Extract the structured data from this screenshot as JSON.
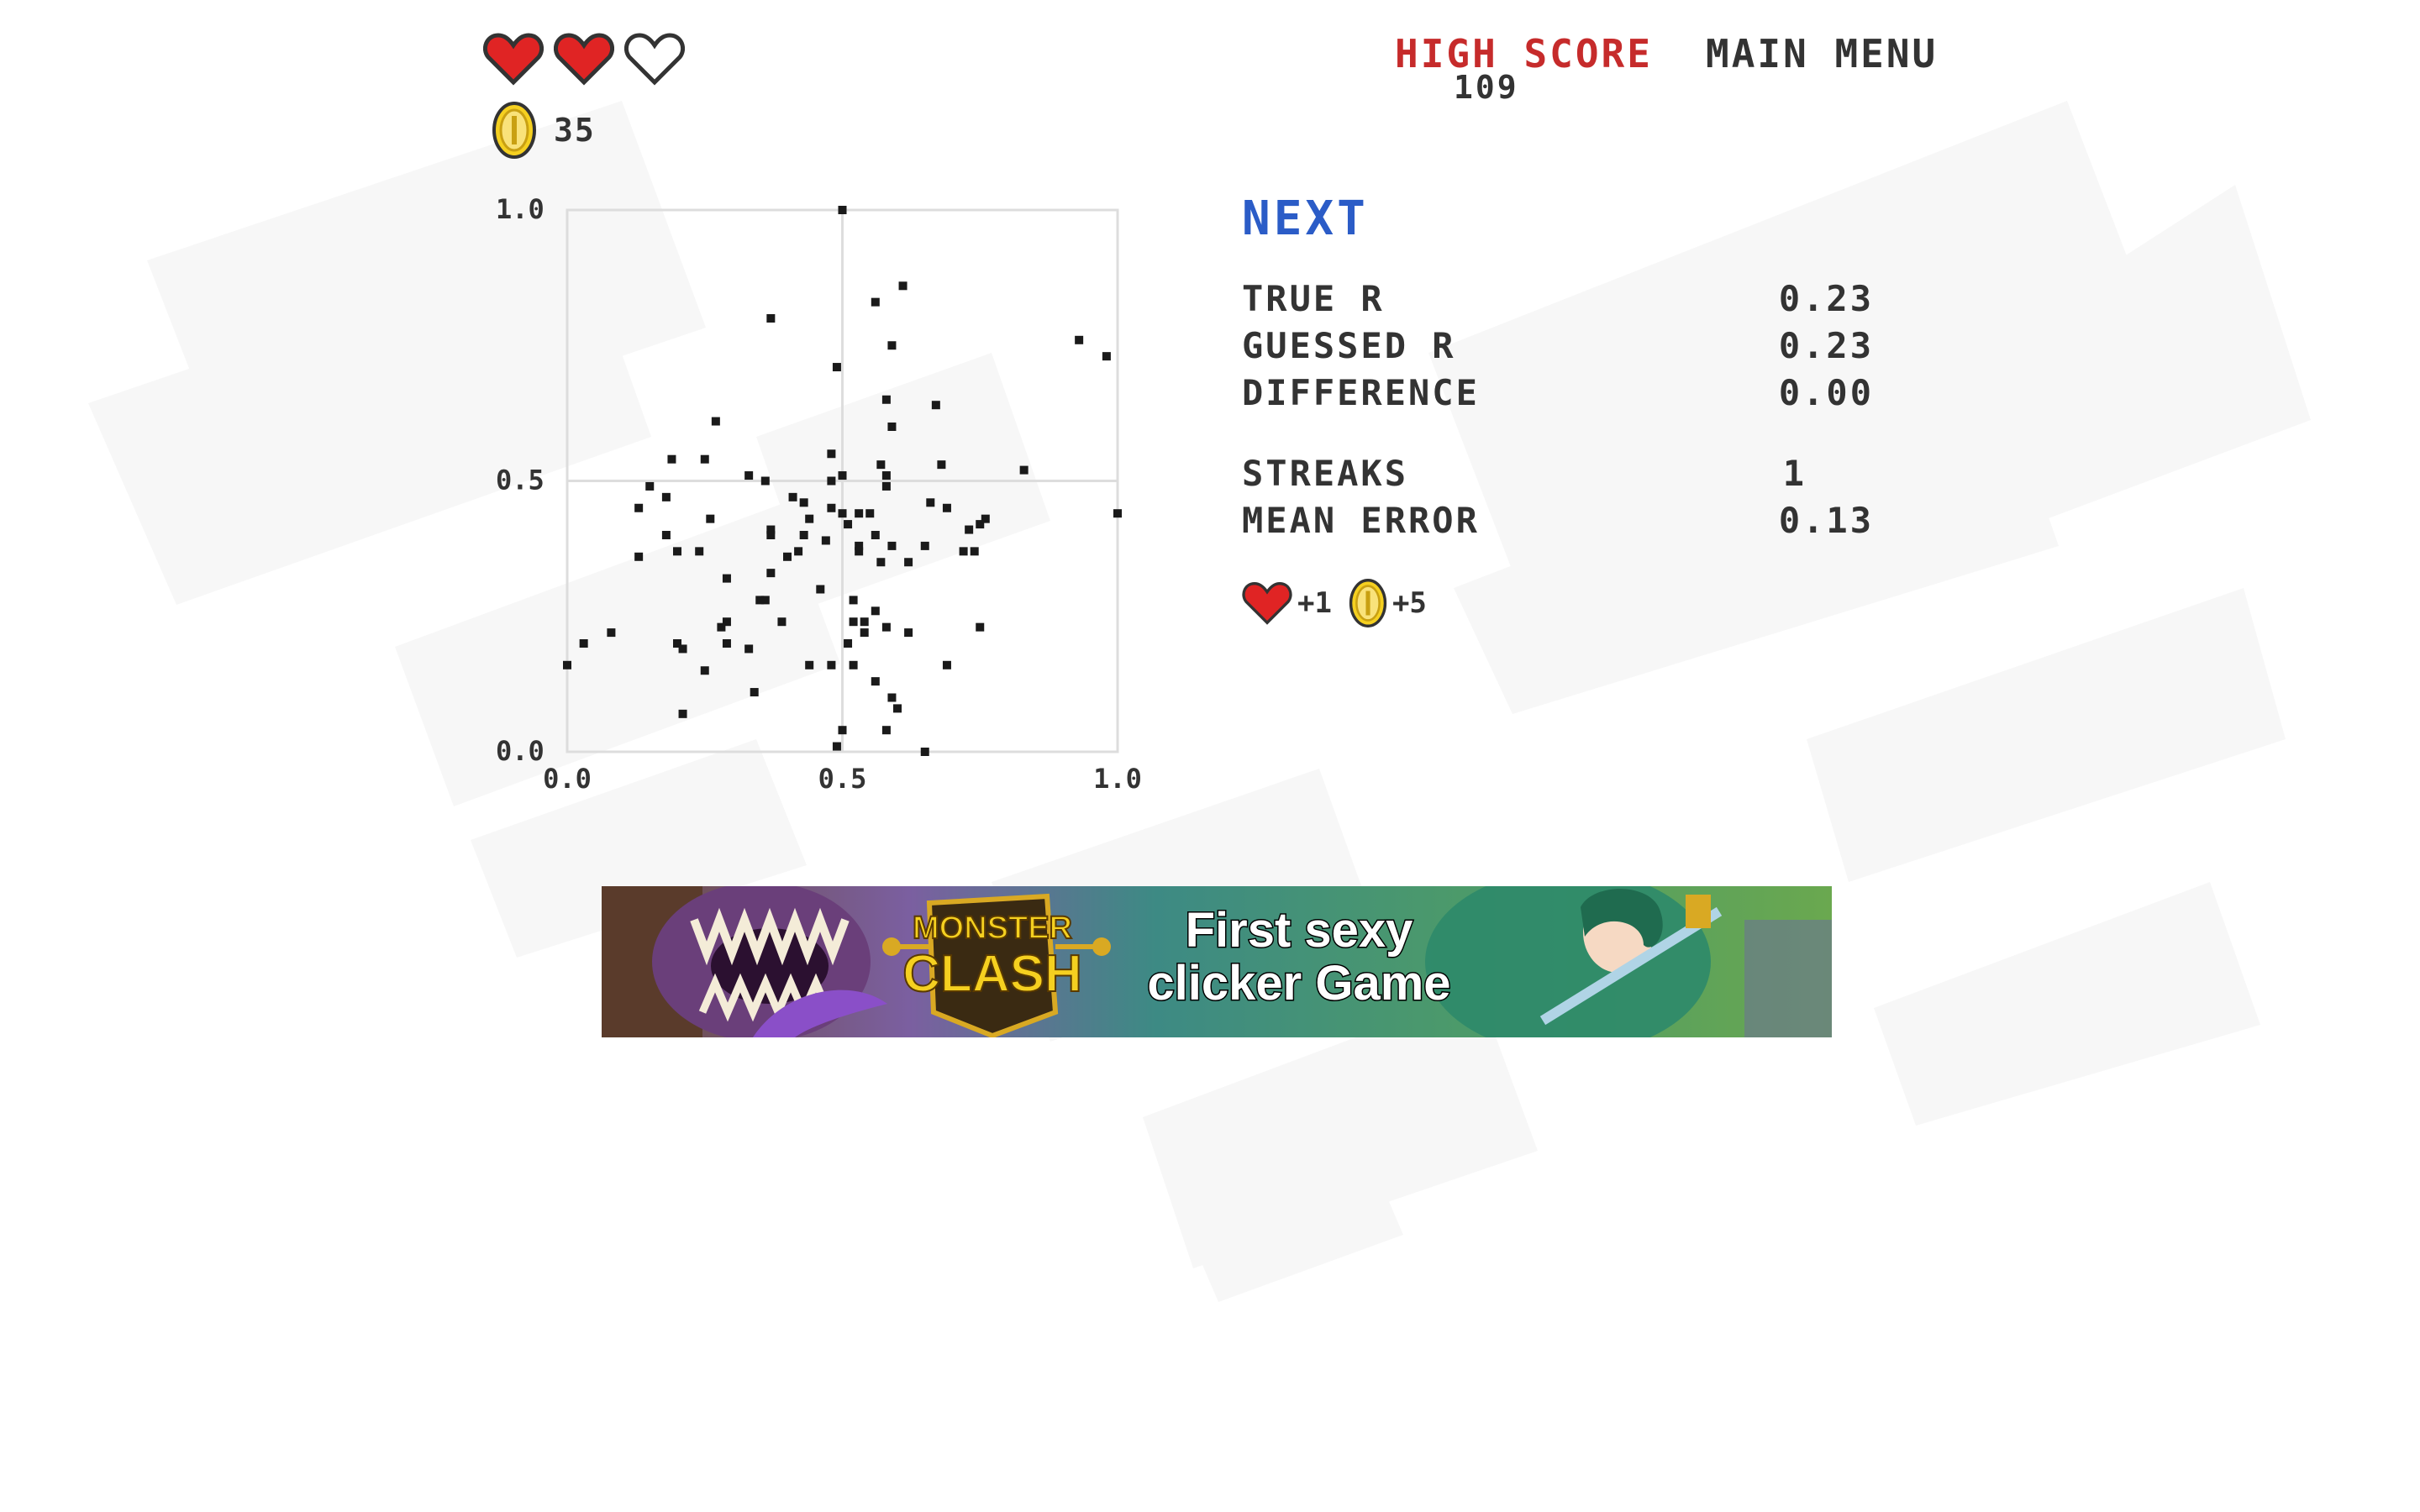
{
  "hud": {
    "hearts": [
      {
        "filled": true,
        "icon": "heart-full-icon"
      },
      {
        "filled": true,
        "icon": "heart-full-icon"
      },
      {
        "filled": false,
        "icon": "heart-empty-icon"
      }
    ],
    "coins": "35",
    "high_score_label": "HIGH SCORE",
    "high_score_value": "109",
    "main_menu_label": "MAIN MENU"
  },
  "panel": {
    "next_label": "NEXT",
    "stats": [
      {
        "label": "TRUE R",
        "value": "0.23"
      },
      {
        "label": "GUESSED R",
        "value": "0.23"
      },
      {
        "label": "DIFFERENCE",
        "value": "0.00"
      }
    ],
    "stats2": [
      {
        "label": "STREAKS",
        "value": "1"
      },
      {
        "label": "MEAN ERROR",
        "value": "0.13"
      }
    ],
    "reward_hearts": "+1",
    "reward_coins": "+5"
  },
  "ad": {
    "logo_top": "MONSTER",
    "logo_bottom": "CLASH",
    "line1": "First sexy",
    "line2": "clicker Game"
  },
  "colors": {
    "heart": "#e02424",
    "coin": "#f5d020",
    "high_score": "#c62b2b",
    "next": "#2b5cc7",
    "text": "#333333",
    "grid": "#dddddd"
  },
  "chart_data": {
    "type": "scatter",
    "xlim": [
      0,
      1
    ],
    "ylim": [
      0,
      1
    ],
    "xticks": [
      "0.0",
      "0.5",
      "1.0"
    ],
    "yticks": [
      "0.0",
      "0.5",
      "1.0"
    ],
    "grid": true,
    "points": [
      [
        0.5,
        1.0
      ],
      [
        0.61,
        0.86
      ],
      [
        0.56,
        0.83
      ],
      [
        0.37,
        0.8
      ],
      [
        0.93,
        0.76
      ],
      [
        0.98,
        0.73
      ],
      [
        0.59,
        0.75
      ],
      [
        0.49,
        0.71
      ],
      [
        0.58,
        0.65
      ],
      [
        0.67,
        0.64
      ],
      [
        0.27,
        0.61
      ],
      [
        0.59,
        0.6
      ],
      [
        0.19,
        0.54
      ],
      [
        0.25,
        0.54
      ],
      [
        0.48,
        0.55
      ],
      [
        0.57,
        0.53
      ],
      [
        0.68,
        0.53
      ],
      [
        0.83,
        0.52
      ],
      [
        0.33,
        0.51
      ],
      [
        0.36,
        0.5
      ],
      [
        0.48,
        0.5
      ],
      [
        0.5,
        0.51
      ],
      [
        0.58,
        0.51
      ],
      [
        0.58,
        0.49
      ],
      [
        0.15,
        0.49
      ],
      [
        0.18,
        0.47
      ],
      [
        0.41,
        0.47
      ],
      [
        0.43,
        0.46
      ],
      [
        0.66,
        0.46
      ],
      [
        0.13,
        0.45
      ],
      [
        0.48,
        0.45
      ],
      [
        0.5,
        0.44
      ],
      [
        0.53,
        0.44
      ],
      [
        0.55,
        0.44
      ],
      [
        0.69,
        0.45
      ],
      [
        0.26,
        0.43
      ],
      [
        0.44,
        0.43
      ],
      [
        0.76,
        0.43
      ],
      [
        0.75,
        0.42
      ],
      [
        0.51,
        0.42
      ],
      [
        0.73,
        0.41
      ],
      [
        0.37,
        0.41
      ],
      [
        0.37,
        0.4
      ],
      [
        0.18,
        0.4
      ],
      [
        0.43,
        0.4
      ],
      [
        0.56,
        0.4
      ],
      [
        0.47,
        0.39
      ],
      [
        0.53,
        0.38
      ],
      [
        0.59,
        0.38
      ],
      [
        0.65,
        0.38
      ],
      [
        0.72,
        0.37
      ],
      [
        0.2,
        0.37
      ],
      [
        0.24,
        0.37
      ],
      [
        0.42,
        0.37
      ],
      [
        0.53,
        0.37
      ],
      [
        0.74,
        0.37
      ],
      [
        0.13,
        0.36
      ],
      [
        0.4,
        0.36
      ],
      [
        0.62,
        0.35
      ],
      [
        0.57,
        0.35
      ],
      [
        0.29,
        0.32
      ],
      [
        0.37,
        0.33
      ],
      [
        0.46,
        0.3
      ],
      [
        0.35,
        0.28
      ],
      [
        0.36,
        0.28
      ],
      [
        0.52,
        0.28
      ],
      [
        0.56,
        0.26
      ],
      [
        0.29,
        0.24
      ],
      [
        0.39,
        0.24
      ],
      [
        0.52,
        0.24
      ],
      [
        0.54,
        0.24
      ],
      [
        0.58,
        0.23
      ],
      [
        0.62,
        0.22
      ],
      [
        0.75,
        0.23
      ],
      [
        0.08,
        0.22
      ],
      [
        0.28,
        0.23
      ],
      [
        0.54,
        0.22
      ],
      [
        0.03,
        0.2
      ],
      [
        0.2,
        0.2
      ],
      [
        0.21,
        0.19
      ],
      [
        0.29,
        0.2
      ],
      [
        0.33,
        0.19
      ],
      [
        0.51,
        0.2
      ],
      [
        0.0,
        0.16
      ],
      [
        0.44,
        0.16
      ],
      [
        0.48,
        0.16
      ],
      [
        0.52,
        0.16
      ],
      [
        0.69,
        0.16
      ],
      [
        0.25,
        0.15
      ],
      [
        0.56,
        0.13
      ],
      [
        0.34,
        0.11
      ],
      [
        0.59,
        0.1
      ],
      [
        0.6,
        0.08
      ],
      [
        0.21,
        0.07
      ],
      [
        0.5,
        0.04
      ],
      [
        0.58,
        0.04
      ],
      [
        0.49,
        0.01
      ],
      [
        0.65,
        0.0
      ],
      [
        1.0,
        0.44
      ]
    ]
  }
}
